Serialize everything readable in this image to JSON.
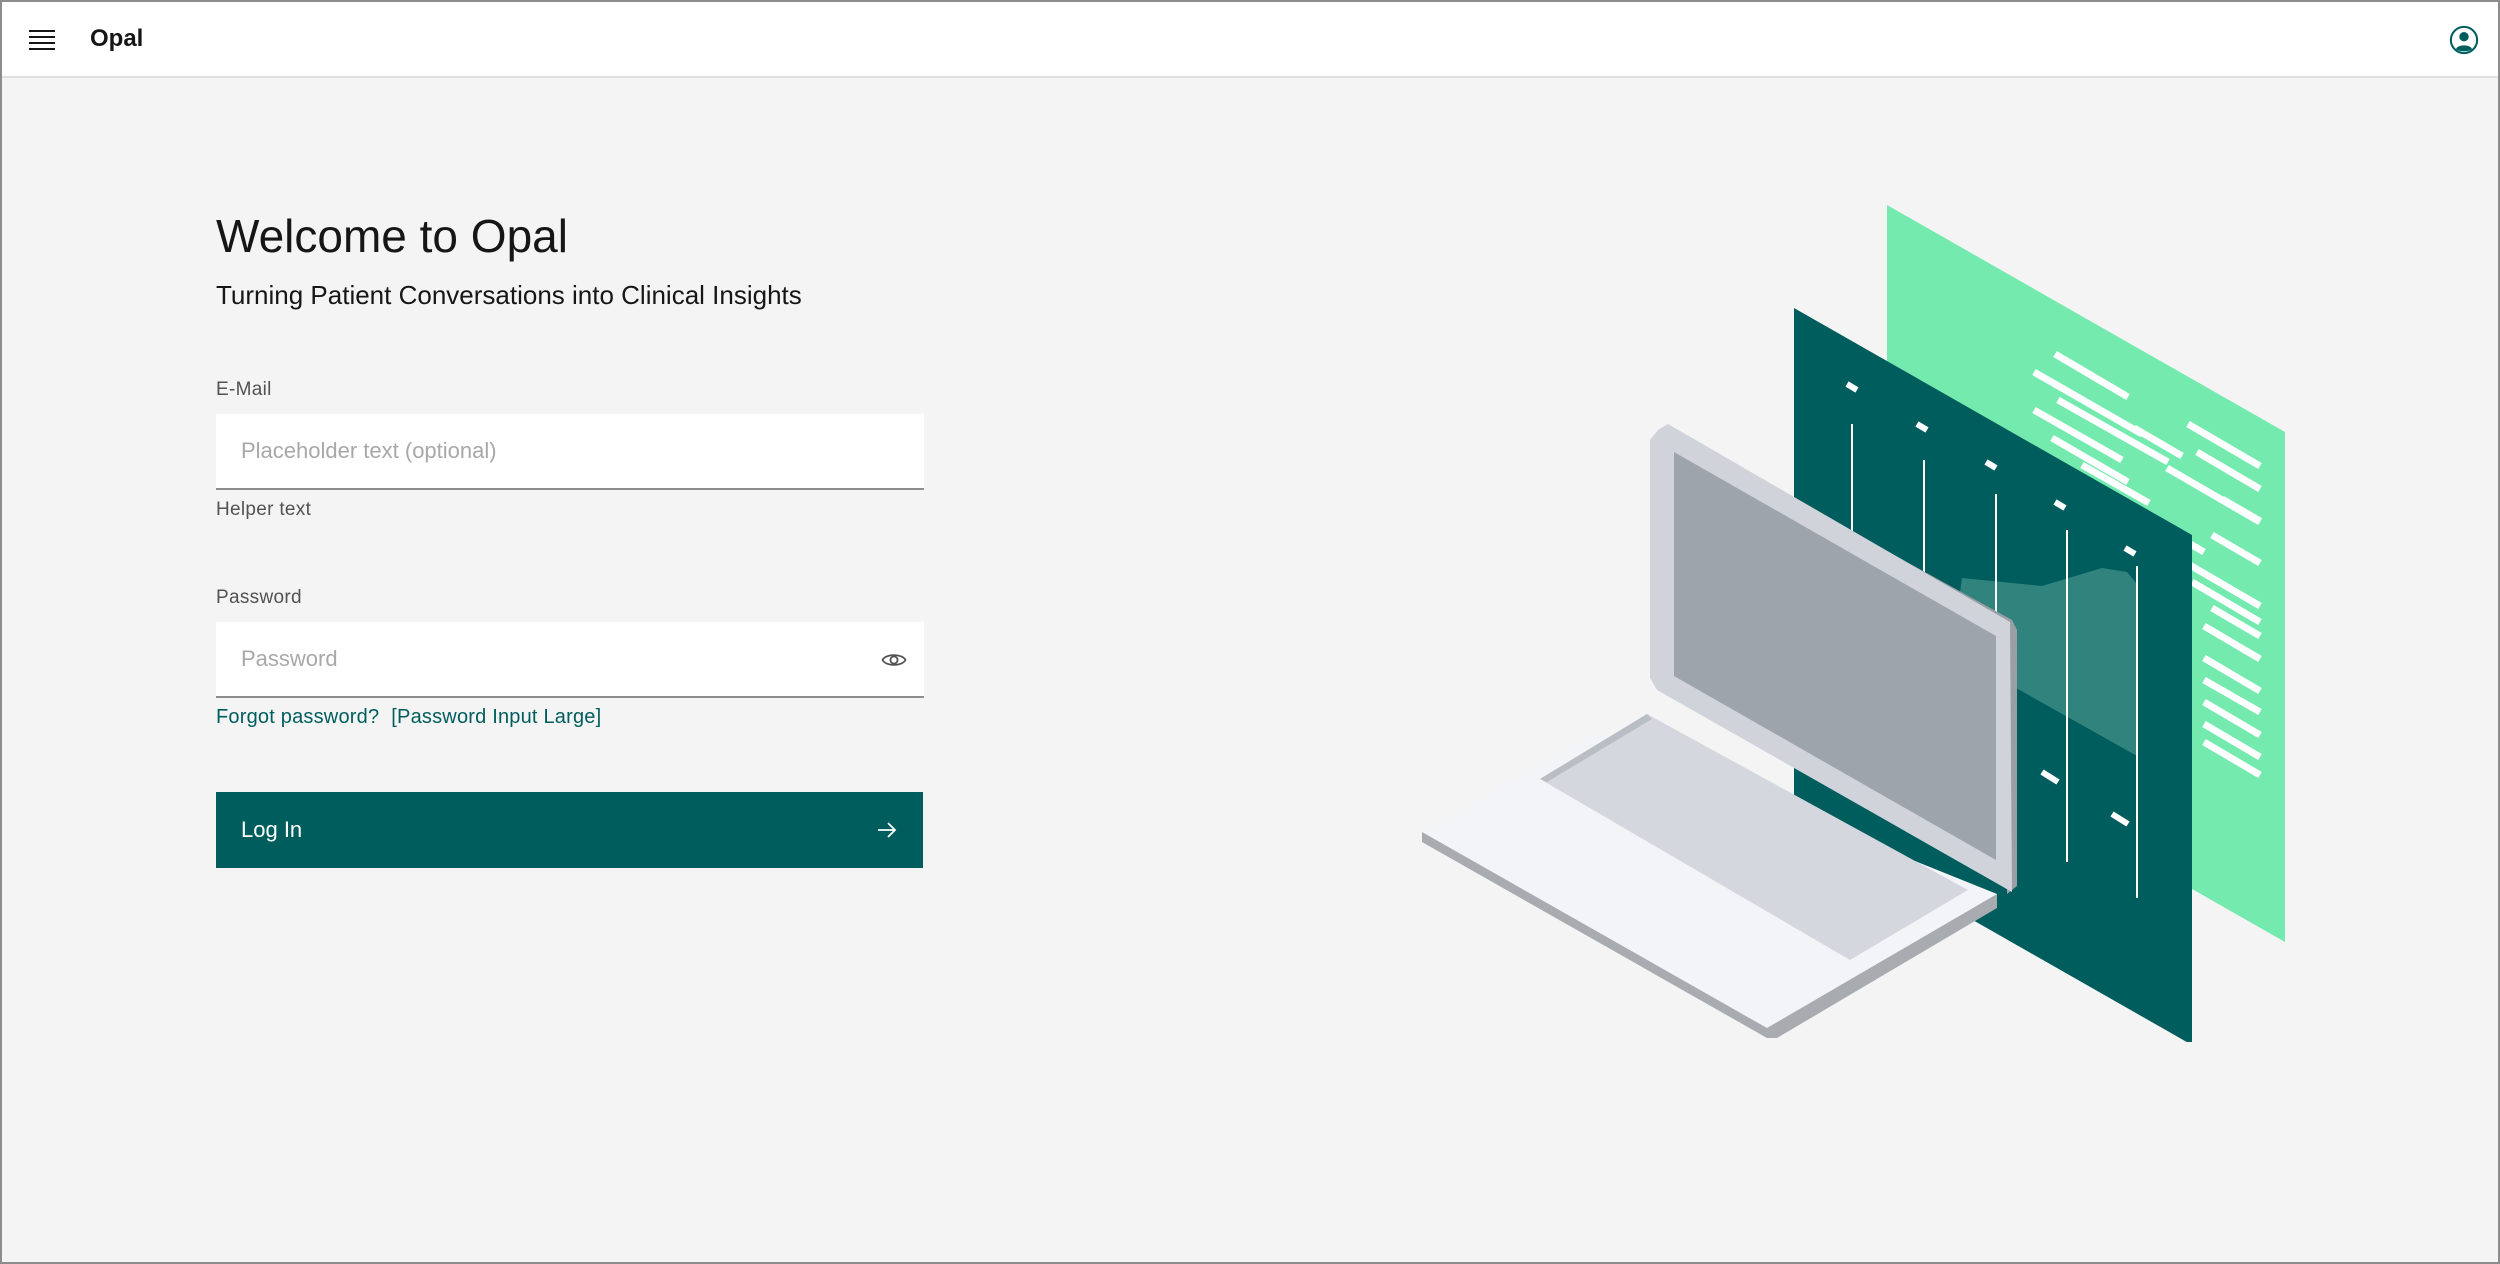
{
  "header": {
    "app_name": "Opal",
    "menu_icon": "hamburger-menu-icon",
    "user_icon": "user-avatar-icon"
  },
  "login": {
    "title": "Welcome to Opal",
    "subtitle": "Turning Patient Conversations into Clinical Insights",
    "email": {
      "label": "E-Mail",
      "placeholder": "Placeholder text (optional)",
      "value": "",
      "helper": "Helper text"
    },
    "password": {
      "label": "Password",
      "placeholder": "Password",
      "value": "",
      "toggle_icon": "eye-icon"
    },
    "forgot_link": "Forgot password?",
    "variant_link": "[Password Input Large]",
    "submit_label": "Log In",
    "submit_icon": "arrow-right-icon"
  },
  "colors": {
    "brand": "#005d5d",
    "accent": "#6fdc8c",
    "background": "#f4f4f4",
    "header": "#ffffff"
  }
}
